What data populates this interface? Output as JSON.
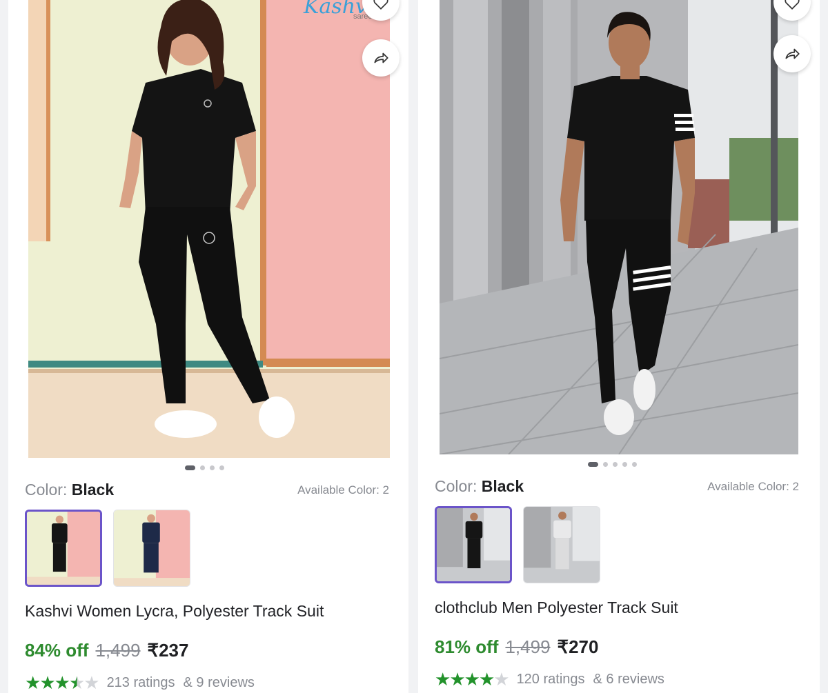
{
  "products": [
    {
      "brand_logo": "Kashvi",
      "brand_logo_sub": "sarees",
      "image_dots": 4,
      "active_dot": 0,
      "color_prefix": "Color:",
      "color_value": "Black",
      "available_colors": "Available Color: 2",
      "title": "Kashvi Women Lycra, Polyester Track Suit",
      "discount": "84% off",
      "mrp": "1,499",
      "price": "₹237",
      "rating": 3.5,
      "ratings_text": "213 ratings",
      "reviews_text": "& 9 reviews",
      "icons": [
        "heart-icon",
        "share-icon"
      ]
    },
    {
      "image_dots": 5,
      "active_dot": 0,
      "color_prefix": "Color:",
      "color_value": "Black",
      "available_colors": "Available Color: 2",
      "title": "clothclub Men Polyester Track Suit",
      "discount": "81% off",
      "mrp": "1,499",
      "price": "₹270",
      "rating": 4,
      "ratings_text": "120 ratings",
      "reviews_text": "& 6 reviews",
      "icons": [
        "heart-icon",
        "share-icon"
      ]
    }
  ],
  "colors": {
    "discount": "#2e8b2f",
    "star": "#22922b",
    "selected_border": "#6b54c9"
  }
}
